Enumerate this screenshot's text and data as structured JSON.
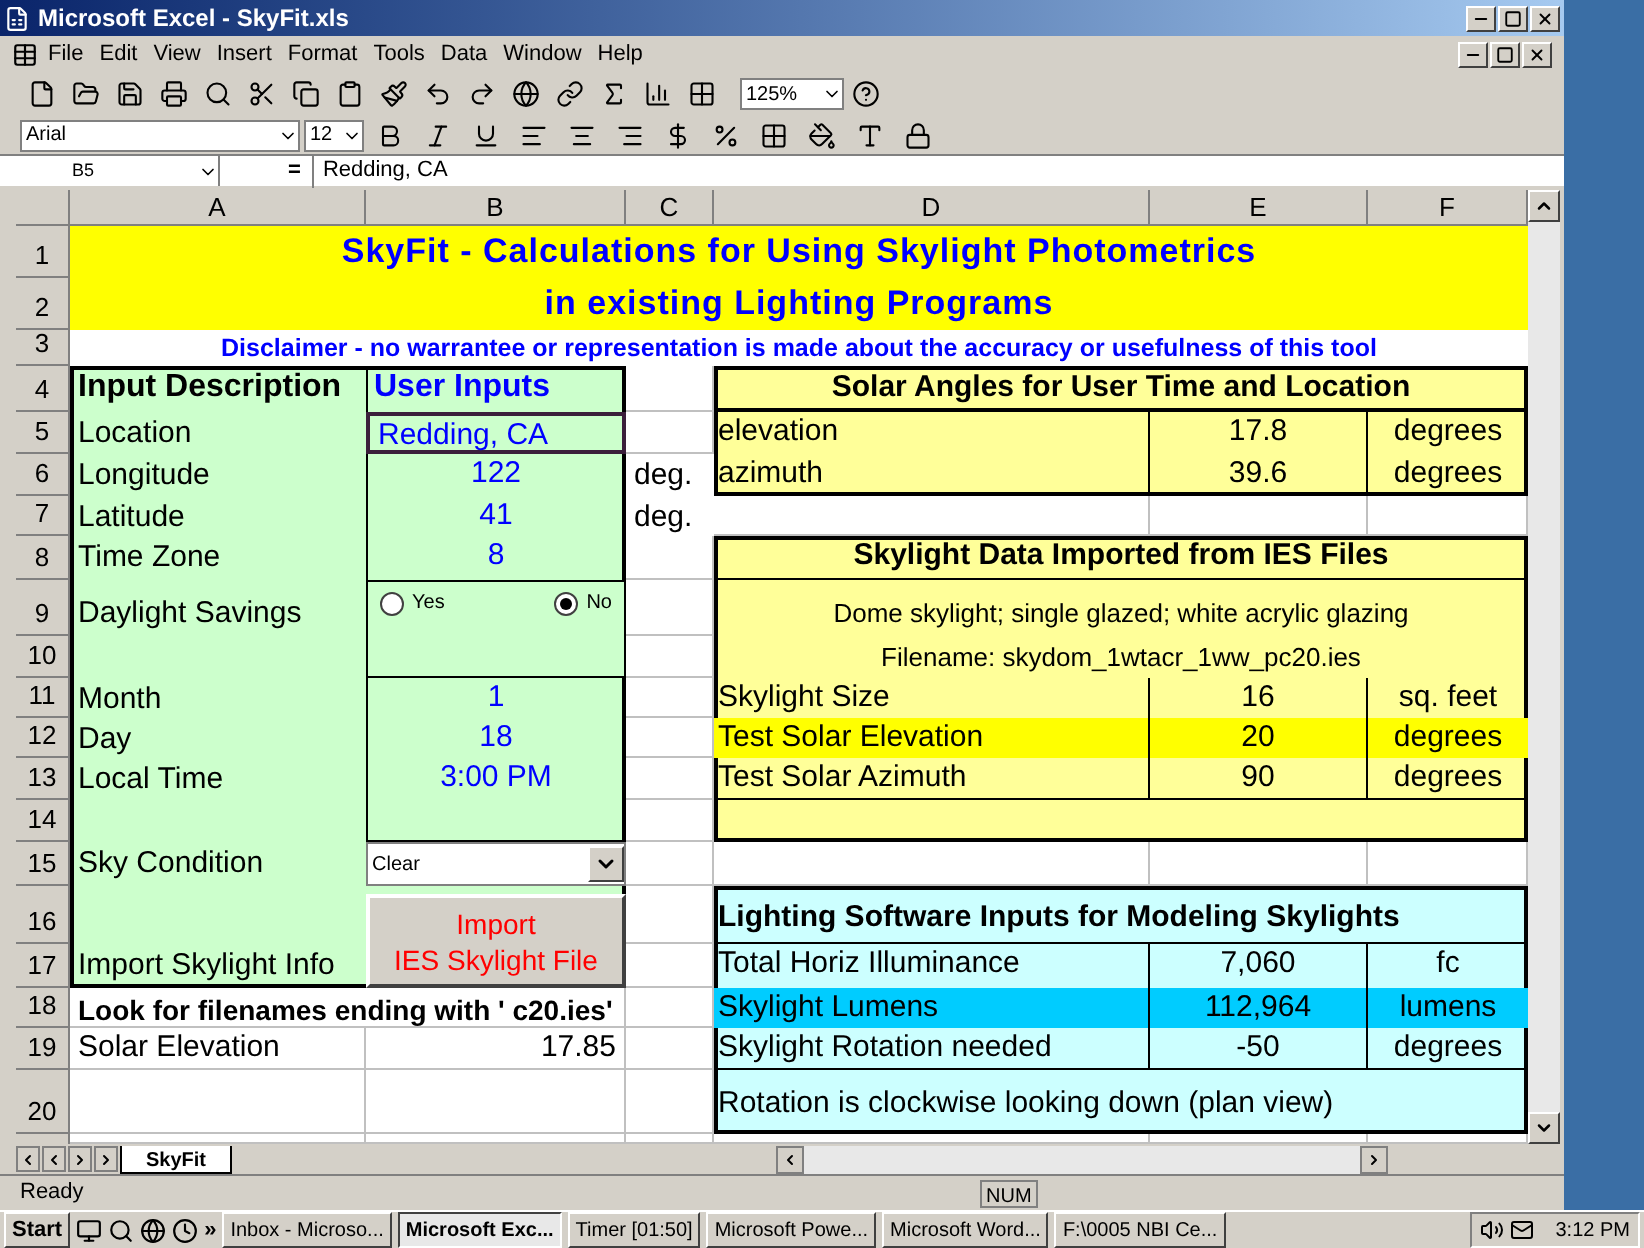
{
  "window": {
    "title": "Microsoft Excel - SkyFit.xls"
  },
  "menu": [
    "File",
    "Edit",
    "View",
    "Insert",
    "Format",
    "Tools",
    "Data",
    "Window",
    "Help"
  ],
  "toolbar": {
    "zoom": "125%",
    "font": "Arial",
    "size": "12"
  },
  "formula_bar": {
    "name_box": "B5",
    "equals": "=",
    "content": "Redding, CA"
  },
  "columns": [
    "A",
    "B",
    "C",
    "D",
    "E",
    "F"
  ],
  "rows": [
    "1",
    "2",
    "3",
    "4",
    "5",
    "6",
    "7",
    "8",
    "9",
    "10",
    "11",
    "12",
    "13",
    "14",
    "15",
    "16",
    "17",
    "18",
    "19",
    "20"
  ],
  "title_lines": [
    "SkyFit - Calculations for Using Skylight Photometrics",
    "in existing Lighting Programs"
  ],
  "disclaimer": "Disclaimer - no warrantee or representation is made about the accuracy or usefulness of this tool",
  "inputs": {
    "header_label": "Input Description",
    "header_value": "User Inputs",
    "rows": [
      {
        "kind": "text",
        "label": "Location",
        "value": "Redding, CA",
        "selected": true
      },
      {
        "kind": "text",
        "label": "Longitude",
        "value": "122",
        "unit": "deg.",
        "selected": false
      },
      {
        "kind": "text",
        "label": "Latitude",
        "value": "41",
        "unit": "deg.",
        "selected": false
      },
      {
        "kind": "text",
        "label": "Time Zone",
        "value": "8",
        "selected": false
      },
      {
        "kind": "radio",
        "label": "Daylight Savings",
        "options": [
          {
            "label": "Yes",
            "selected": false
          },
          {
            "label": "No",
            "selected": true
          }
        ]
      },
      {
        "kind": "text",
        "label": "Month",
        "value": "1",
        "selected": false
      },
      {
        "kind": "text",
        "label": "Day",
        "value": "18",
        "selected": false
      },
      {
        "kind": "text",
        "label": "Local Time",
        "value": "3:00 PM",
        "selected": false
      },
      {
        "kind": "dropdown",
        "label": "Sky Condition",
        "value": "Clear"
      },
      {
        "kind": "button",
        "label": "Import Skylight Info",
        "button_lines": [
          "Import",
          "IES Skylight File"
        ]
      }
    ]
  },
  "note": "Look for filenames ending with ' c20.ies'",
  "solar_elevation": {
    "label": "Solar Elevation",
    "value": "17.85"
  },
  "solar_angles": {
    "title": "Solar Angles for User Time and Location",
    "rows": [
      {
        "label": "elevation",
        "value": "17.8",
        "unit": "degrees"
      },
      {
        "label": "azimuth",
        "value": "39.6",
        "unit": "degrees"
      }
    ]
  },
  "skylight_data": {
    "title": "Skylight Data Imported from IES Files",
    "description": "Dome skylight; single glazed; white acrylic glazing",
    "filename": "Filename: skydom_1wtacr_1ww_pc20.ies",
    "rows": [
      {
        "label": "Skylight Size",
        "value": "16",
        "unit": "sq. feet",
        "highlighted": false
      },
      {
        "label": "Test Solar Elevation",
        "value": "20",
        "unit": "degrees",
        "highlighted": true
      },
      {
        "label": "Test Solar Azimuth",
        "value": "90",
        "unit": "degrees",
        "highlighted": false
      }
    ]
  },
  "software_inputs": {
    "title": "Lighting Software Inputs for Modeling Skylights",
    "rows": [
      {
        "label": "Total Horiz Illuminance",
        "value": "7,060",
        "unit": "fc",
        "highlighted": false
      },
      {
        "label": "Skylight Lumens",
        "value": "112,964",
        "unit": "lumens",
        "highlighted": true
      },
      {
        "label": "Skylight Rotation needed",
        "value": "-50",
        "unit": "degrees",
        "highlighted": false
      }
    ],
    "note": "Rotation is clockwise looking down (plan view)"
  },
  "sheet_tabs": [
    {
      "label": "SkyFit",
      "selected": true
    }
  ],
  "status": {
    "text": "Ready",
    "indicator": "NUM"
  },
  "taskbar": {
    "start": "Start",
    "chevron": "»",
    "tasks": [
      {
        "label": "Inbox - Microso...",
        "selected": false
      },
      {
        "label": "Microsoft Exc...",
        "selected": true
      },
      {
        "label": "Timer  [01:50]",
        "selected": false
      },
      {
        "label": "Microsoft Powe...",
        "selected": false
      },
      {
        "label": "Microsoft Word...",
        "selected": false
      },
      {
        "label": "F:\\0005 NBI Ce...",
        "selected": false
      }
    ],
    "clock": "3:12 PM"
  }
}
